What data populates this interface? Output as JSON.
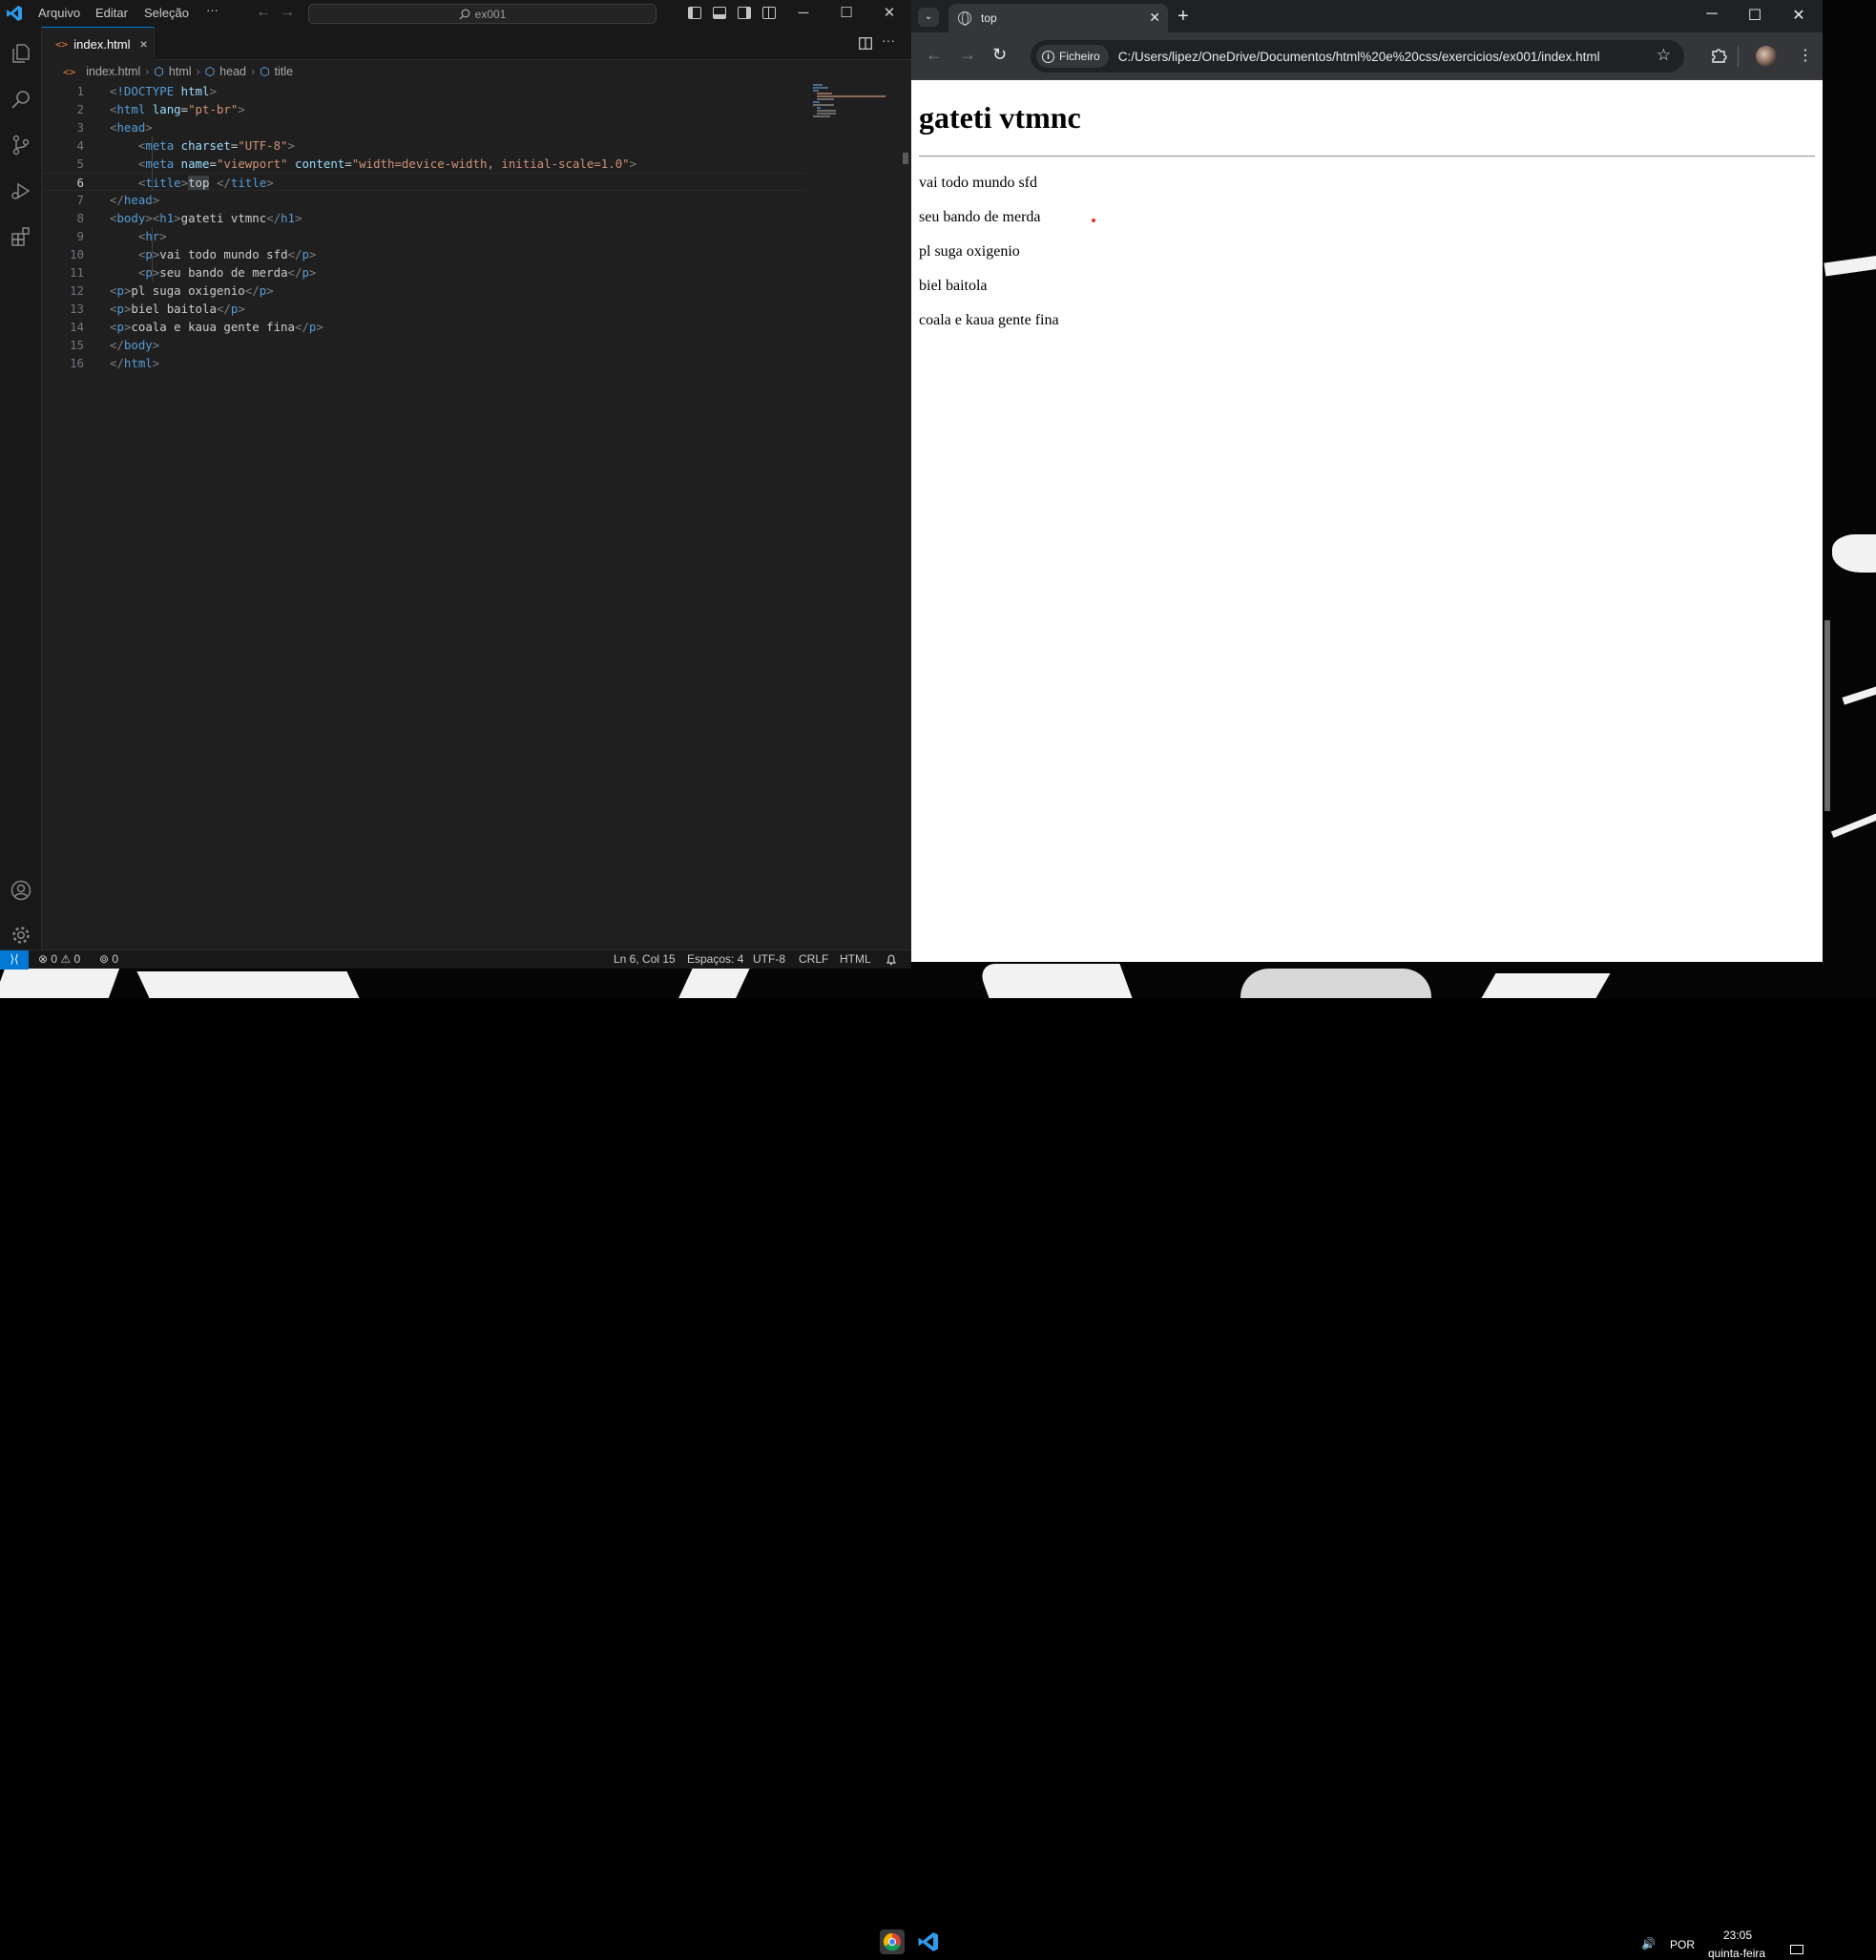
{
  "vscode": {
    "menu": [
      "Arquivo",
      "Editar",
      "Seleção",
      "···"
    ],
    "search_text": "ex001",
    "tab": {
      "label": "index.html",
      "close": "×"
    },
    "breadcrumb": [
      "index.html",
      "html",
      "head",
      "title"
    ],
    "code": [
      {
        "n": "1",
        "tokens": [
          [
            "br",
            "<"
          ],
          [
            "tag",
            "!DOCTYPE"
          ],
          [
            "txt",
            " "
          ],
          [
            "attr",
            "html"
          ],
          [
            "br",
            ">"
          ]
        ]
      },
      {
        "n": "2",
        "tokens": [
          [
            "br",
            "<"
          ],
          [
            "tag",
            "html"
          ],
          [
            "txt",
            " "
          ],
          [
            "attr",
            "lang"
          ],
          [
            "txt",
            "="
          ],
          [
            "val",
            "\"pt-br\""
          ],
          [
            "br",
            ">"
          ]
        ]
      },
      {
        "n": "3",
        "tokens": [
          [
            "br",
            "<"
          ],
          [
            "tag",
            "head"
          ],
          [
            "br",
            ">"
          ]
        ]
      },
      {
        "n": "4",
        "tokens": [
          [
            "txt",
            "    "
          ],
          [
            "br",
            "<"
          ],
          [
            "tag",
            "meta"
          ],
          [
            "txt",
            " "
          ],
          [
            "attr",
            "charset"
          ],
          [
            "txt",
            "="
          ],
          [
            "val",
            "\"UTF-8\""
          ],
          [
            "br",
            ">"
          ]
        ]
      },
      {
        "n": "5",
        "tokens": [
          [
            "txt",
            "    "
          ],
          [
            "br",
            "<"
          ],
          [
            "tag",
            "meta"
          ],
          [
            "txt",
            " "
          ],
          [
            "attr",
            "name"
          ],
          [
            "txt",
            "="
          ],
          [
            "val",
            "\"viewport\""
          ],
          [
            "txt",
            " "
          ],
          [
            "attr",
            "content"
          ],
          [
            "txt",
            "="
          ],
          [
            "val",
            "\"width=device-width, initial-scale=1.0\""
          ],
          [
            "br",
            ">"
          ]
        ]
      },
      {
        "n": "6",
        "tokens": [
          [
            "txt",
            "    "
          ],
          [
            "br",
            "<"
          ],
          [
            "tag",
            "title"
          ],
          [
            "br",
            ">"
          ],
          [
            "sel",
            "top"
          ],
          [
            "txt",
            " "
          ],
          [
            "br",
            "</"
          ],
          [
            "tag",
            "title"
          ],
          [
            "br",
            ">"
          ]
        ]
      },
      {
        "n": "7",
        "tokens": [
          [
            "br",
            "</"
          ],
          [
            "tag",
            "head"
          ],
          [
            "br",
            ">"
          ]
        ]
      },
      {
        "n": "8",
        "tokens": [
          [
            "br",
            "<"
          ],
          [
            "tag",
            "body"
          ],
          [
            "br",
            ">"
          ],
          [
            "br",
            "<"
          ],
          [
            "tag",
            "h1"
          ],
          [
            "br",
            ">"
          ],
          [
            "txt",
            "gateti vtmnc"
          ],
          [
            "br",
            "</"
          ],
          [
            "tag",
            "h1"
          ],
          [
            "br",
            ">"
          ]
        ]
      },
      {
        "n": "9",
        "tokens": [
          [
            "txt",
            "    "
          ],
          [
            "br",
            "<"
          ],
          [
            "tag",
            "hr"
          ],
          [
            "br",
            ">"
          ]
        ]
      },
      {
        "n": "10",
        "tokens": [
          [
            "txt",
            "    "
          ],
          [
            "br",
            "<"
          ],
          [
            "tag",
            "p"
          ],
          [
            "br",
            ">"
          ],
          [
            "txt",
            "vai todo mundo sfd"
          ],
          [
            "br",
            "</"
          ],
          [
            "tag",
            "p"
          ],
          [
            "br",
            ">"
          ]
        ]
      },
      {
        "n": "11",
        "tokens": [
          [
            "txt",
            "    "
          ],
          [
            "br",
            "<"
          ],
          [
            "tag",
            "p"
          ],
          [
            "br",
            ">"
          ],
          [
            "txt",
            "seu bando de merda"
          ],
          [
            "br",
            "</"
          ],
          [
            "tag",
            "p"
          ],
          [
            "br",
            ">"
          ]
        ]
      },
      {
        "n": "12",
        "tokens": [
          [
            "br",
            "<"
          ],
          [
            "tag",
            "p"
          ],
          [
            "br",
            ">"
          ],
          [
            "txt",
            "pl suga oxigenio"
          ],
          [
            "br",
            "</"
          ],
          [
            "tag",
            "p"
          ],
          [
            "br",
            ">"
          ]
        ]
      },
      {
        "n": "13",
        "tokens": [
          [
            "br",
            "<"
          ],
          [
            "tag",
            "p"
          ],
          [
            "br",
            ">"
          ],
          [
            "txt",
            "biel baitola"
          ],
          [
            "br",
            "</"
          ],
          [
            "tag",
            "p"
          ],
          [
            "br",
            ">"
          ]
        ]
      },
      {
        "n": "14",
        "tokens": [
          [
            "br",
            "<"
          ],
          [
            "tag",
            "p"
          ],
          [
            "br",
            ">"
          ],
          [
            "txt",
            "coala e kaua gente fina"
          ],
          [
            "br",
            "</"
          ],
          [
            "tag",
            "p"
          ],
          [
            "br",
            ">"
          ]
        ]
      },
      {
        "n": "15",
        "tokens": [
          [
            "br",
            "</"
          ],
          [
            "tag",
            "body"
          ],
          [
            "br",
            ">"
          ]
        ]
      },
      {
        "n": "16",
        "tokens": [
          [
            "br",
            "</"
          ],
          [
            "tag",
            "html"
          ],
          [
            "br",
            ">"
          ]
        ]
      }
    ],
    "active_line": "6",
    "status": {
      "problems": "⊗ 0 ⚠ 0",
      "ports": "⊚ 0",
      "position": "Ln 6, Col 15",
      "spaces": "Espaços: 4",
      "encoding": "UTF-8",
      "eol": "CRLF",
      "language": "HTML",
      "bell": "🔔"
    }
  },
  "chrome": {
    "tab_title": "top",
    "site_chip": "Ficheiro",
    "url": "C:/Users/lipez/OneDrive/Documentos/html%20e%20css/exercicios/ex001/index.html",
    "page": {
      "heading": "gateti vtmnc",
      "paragraphs": [
        "vai todo mundo sfd",
        "seu bando de merda",
        "pl suga oxigenio",
        "biel baitola",
        "coala e kaua gente fina"
      ]
    }
  },
  "taskbar": {
    "language": "POR",
    "time": "23:05",
    "day": "quinta-feira"
  },
  "colors": {
    "vs_bg": "#1f1f1f",
    "vs_accent": "#0078d4",
    "tag": "#569cd6",
    "attr": "#9cdcfe",
    "value": "#ce9178",
    "chrome_bg": "#202124"
  }
}
